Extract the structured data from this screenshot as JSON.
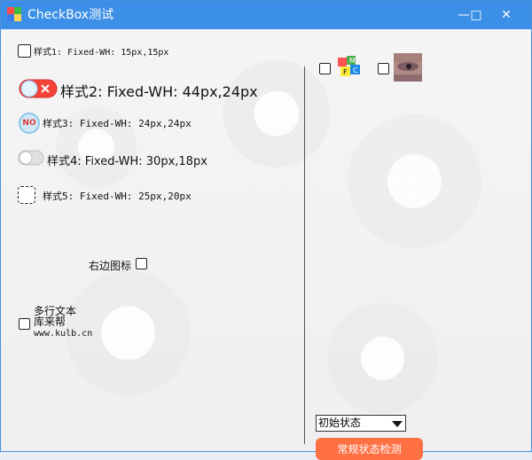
{
  "window": {
    "title": "CheckBox测试",
    "minimize_glyph": "—",
    "maximize_glyph": "□",
    "close_glyph": "✕"
  },
  "left": {
    "style1": {
      "label": "样式1: Fixed-WH: 15px,15px"
    },
    "style2": {
      "label": "样式2: Fixed-WH: 44px,24px"
    },
    "style3": {
      "label": "样式3: Fixed-WH: 24px,24px",
      "badge": "NO"
    },
    "style4": {
      "label": "样式4: Fixed-WH: 30px,18px"
    },
    "style5": {
      "label": "样式5: Fixed-WH: 25px,20px"
    },
    "right_icon_label": "右边图标",
    "multiline": {
      "line1": "多行文本",
      "line2": "库来帮",
      "line3": "www.kulb.cn"
    }
  },
  "right": {
    "select_value": "初始状态",
    "button_label": "常规状态检测"
  },
  "icons": [
    "app-icon",
    "mfc-cube-icon",
    "face-thumbnail-icon",
    "close-x-icon"
  ]
}
